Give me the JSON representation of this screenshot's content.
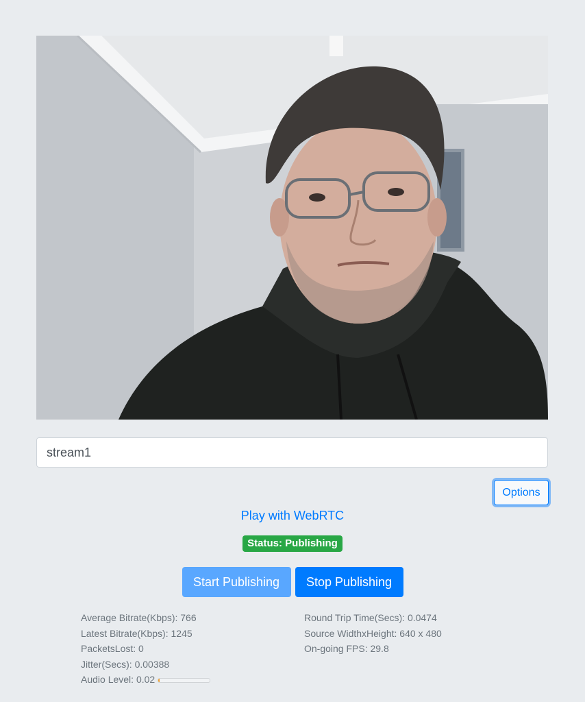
{
  "stream": {
    "name_value": "stream1"
  },
  "options": {
    "label": "Options"
  },
  "play_link": {
    "label": "Play with WebRTC"
  },
  "status": {
    "text": "Status: Publishing",
    "color": "#28a745"
  },
  "actions": {
    "start_label": "Start Publishing",
    "stop_label": "Stop Publishing"
  },
  "stats": {
    "left": [
      {
        "label": "Average Bitrate(Kbps): 766"
      },
      {
        "label": "Latest Bitrate(Kbps): 1245"
      },
      {
        "label": "PacketsLost: 0"
      },
      {
        "label": "Jitter(Secs): 0.00388"
      },
      {
        "label": "Audio Level: 0.02"
      }
    ],
    "right": [
      {
        "label": "Round Trip Time(Secs): 0.0474"
      },
      {
        "label": "Source WidthxHeight: 640 x 480"
      },
      {
        "label": "On-going FPS: 29.8"
      }
    ],
    "audio_level_fraction": 0.02
  },
  "colors": {
    "primary": "#007bff",
    "background": "#e9ecef",
    "success": "#28a745"
  }
}
